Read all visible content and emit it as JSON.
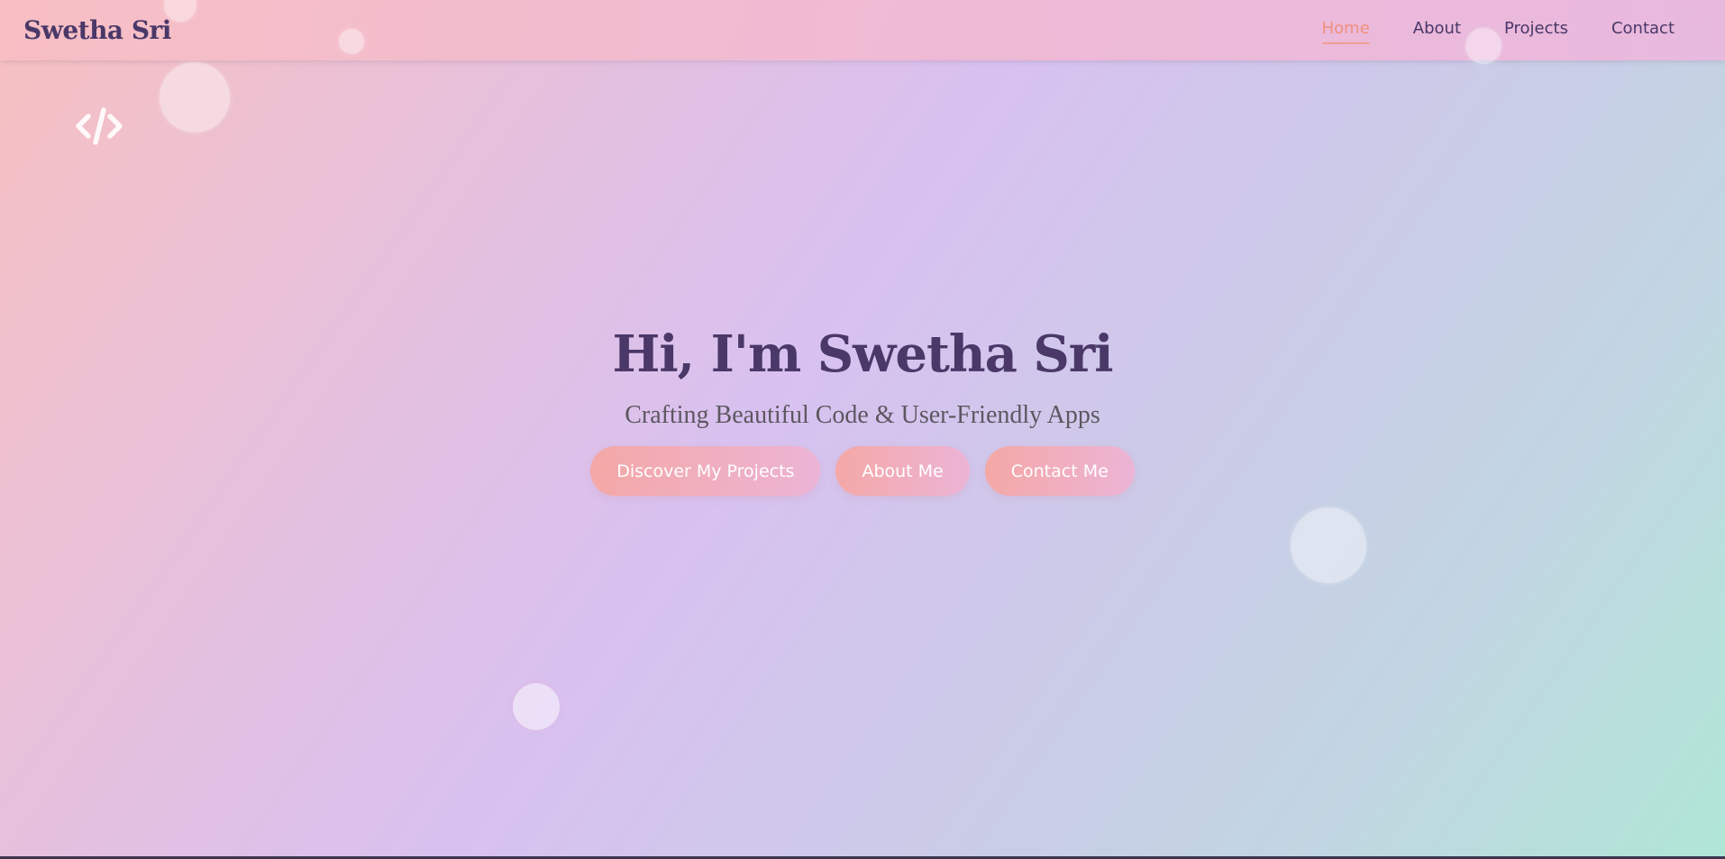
{
  "nav": {
    "brand": "Swetha Sri",
    "links": [
      {
        "label": "Home",
        "active": true
      },
      {
        "label": "About",
        "active": false
      },
      {
        "label": "Projects",
        "active": false
      },
      {
        "label": "Contact",
        "active": false
      }
    ]
  },
  "hero": {
    "title": "Hi, I'm Swetha Sri",
    "subtitle": "Crafting Beautiful Code & User-Friendly Apps",
    "buttons": {
      "projects": "Discover My Projects",
      "about": "About Me",
      "contact": "Contact Me"
    }
  },
  "decor": {
    "icon": "code-icon"
  },
  "colors": {
    "accent": "#f0907e",
    "brand_text": "#4a3868",
    "button_gradient_start": "#f4a8a6",
    "button_gradient_end": "#ecb4d6"
  }
}
